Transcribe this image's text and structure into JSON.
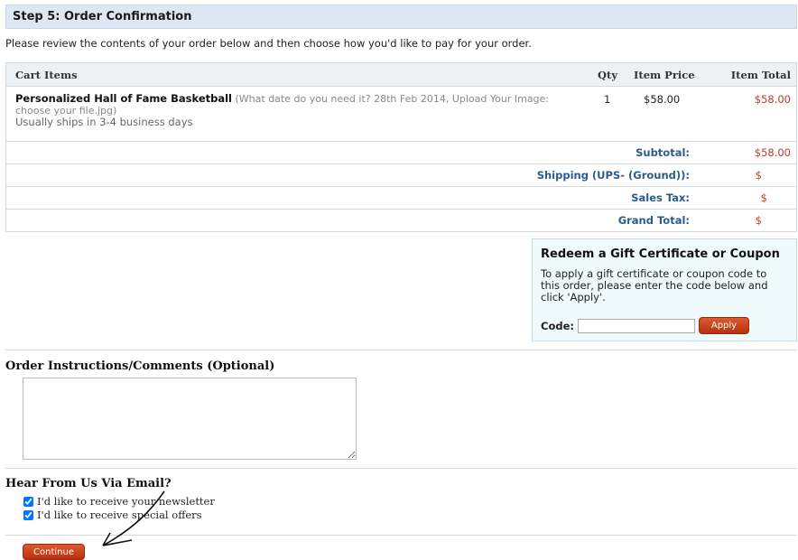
{
  "step": {
    "title": "Step 5: Order Confirmation"
  },
  "intro": "Please review the contents of your order below and then choose how you'd like to pay for your order.",
  "cart": {
    "headers": {
      "items": "Cart Items",
      "qty": "Qty",
      "price": "Item Price",
      "total": "Item Total"
    },
    "items": [
      {
        "name": "Personalized Hall of Fame Basketball",
        "options": "(What date do you need it? 28th Feb 2014, Upload Your Image: choose your file.jpg)",
        "shipping_note": "Usually ships in 3-4 business days",
        "qty": "1",
        "price": "$58.00",
        "total": "$58.00"
      }
    ],
    "summary": {
      "subtotal_label": "Subtotal:",
      "subtotal_value": "$58.00",
      "shipping_label": "Shipping (UPS- (Ground)):",
      "shipping_value": "$",
      "tax_label": "Sales Tax:",
      "tax_value": "$",
      "grand_label": "Grand Total:",
      "grand_value": "$"
    }
  },
  "coupon": {
    "title": "Redeem a Gift Certificate or Coupon",
    "text": "To apply a gift certificate or coupon code to this order, please enter the code below and click 'Apply'.",
    "code_label": "Code:",
    "code_value": "",
    "apply_label": "Apply"
  },
  "instructions": {
    "title": "Order Instructions/Comments (Optional)",
    "value": ""
  },
  "email": {
    "title": "Hear From Us Via Email?",
    "newsletter_label": "I'd like to receive your newsletter",
    "offers_label": "I'd like to receive special offers"
  },
  "continue_label": "Continue",
  "colors": {
    "header_bg": "#dce7f3",
    "accent_red": "#c0392b",
    "summary_blue": "#2b5d8c",
    "coupon_bg": "#effafc"
  }
}
